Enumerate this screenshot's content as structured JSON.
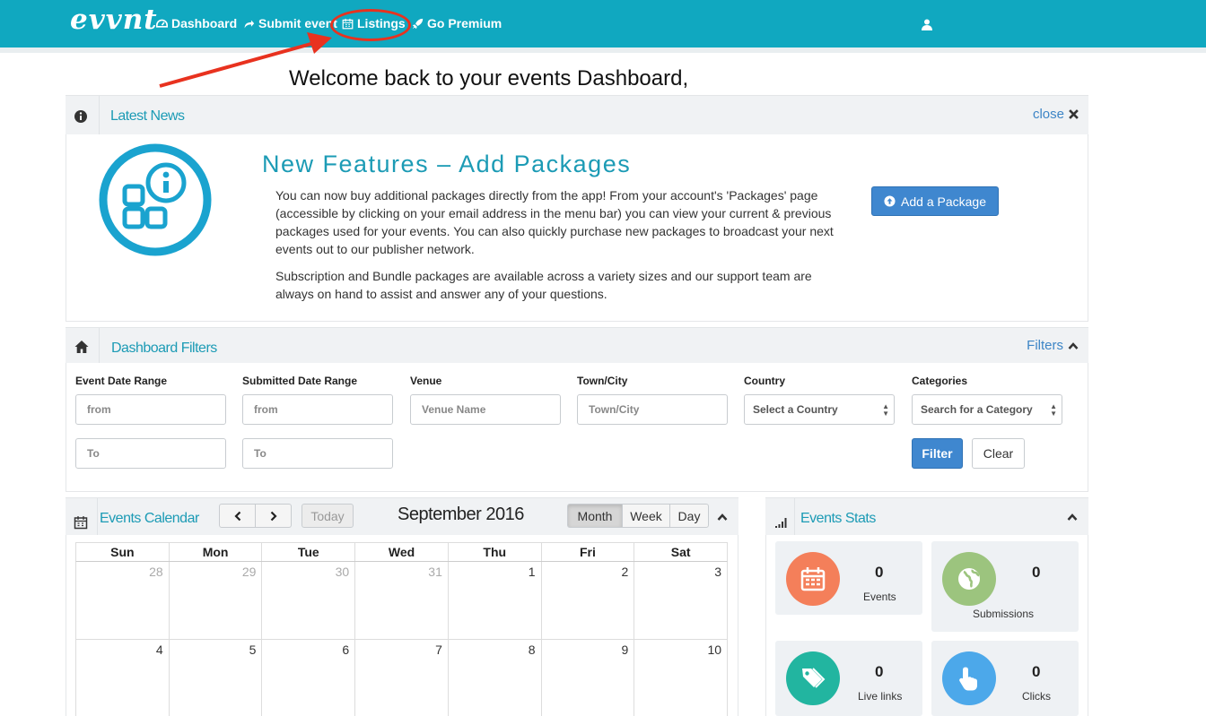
{
  "navbar": {
    "logo": "evvnt",
    "items": [
      {
        "label": "Dashboard",
        "icon": "dashboard-icon"
      },
      {
        "label": "Submit event",
        "icon": "share-icon"
      },
      {
        "label": "Listings",
        "icon": "calendar-icon"
      },
      {
        "label": "Go Premium",
        "icon": "rocket-icon"
      }
    ],
    "user_icon": "user-icon"
  },
  "annotation": {
    "ring_color": "#e8321f",
    "arrow_color": "#e8321f"
  },
  "welcome": "Welcome back to your events Dashboard,",
  "news": {
    "title": "Latest News",
    "close_label": "close",
    "heading": "New Features – Add Packages",
    "paragraph1": "You can now buy additional packages directly from the app! From your account's 'Packages' page (accessible by clicking on your email address in the menu bar) you can view your current & previous packages used for your events. You can also quickly purchase new packages to broadcast your next events out to our publisher network.",
    "paragraph2": "Subscription and Bundle packages are available across a variety sizes and our support team are always on hand to assist and answer any of your questions.",
    "button_label": "Add a Package"
  },
  "filters": {
    "title": "Dashboard Filters",
    "toggle_label": "Filters",
    "labels": [
      "Event Date Range",
      "Submitted Date Range",
      "Venue",
      "Town/City",
      "Country",
      "Categories"
    ],
    "placeholders": {
      "event_from": "from",
      "event_to": "To",
      "submitted_from": "from",
      "submitted_to": "To",
      "venue": "Venue Name",
      "town": "Town/City"
    },
    "country_select": "Select a Country",
    "category_select": "Search for a Category",
    "filter_button": "Filter",
    "clear_button": "Clear"
  },
  "calendar": {
    "title": "Events Calendar",
    "today_label": "Today",
    "month_title": "September 2016",
    "views": [
      "Month",
      "Week",
      "Day"
    ],
    "active_view": "Month",
    "weekdays": [
      "Sun",
      "Mon",
      "Tue",
      "Wed",
      "Thu",
      "Fri",
      "Sat"
    ],
    "weeks": [
      [
        {
          "d": "28",
          "other": true
        },
        {
          "d": "29",
          "other": true
        },
        {
          "d": "30",
          "other": true
        },
        {
          "d": "31",
          "other": true
        },
        {
          "d": "1"
        },
        {
          "d": "2"
        },
        {
          "d": "3"
        }
      ],
      [
        {
          "d": "4"
        },
        {
          "d": "5"
        },
        {
          "d": "6"
        },
        {
          "d": "7"
        },
        {
          "d": "8"
        },
        {
          "d": "9"
        },
        {
          "d": "10"
        }
      ]
    ]
  },
  "stats": {
    "title": "Events Stats",
    "items": [
      {
        "value": "0",
        "label": "Events",
        "color": "#f47f5a",
        "icon": "calendar-icon"
      },
      {
        "value": "0",
        "label": "Submissions",
        "color": "#9cc47e",
        "icon": "globe-icon"
      },
      {
        "value": "0",
        "label": "Live links",
        "color": "#22b5a0",
        "icon": "tags-icon"
      },
      {
        "value": "0",
        "label": "Clicks",
        "color": "#4ca8ea",
        "icon": "pointer-hand-icon"
      }
    ]
  },
  "colors": {
    "brand": "#10a8c0",
    "title": "#1c9bb5",
    "primary": "#3f87cf"
  }
}
